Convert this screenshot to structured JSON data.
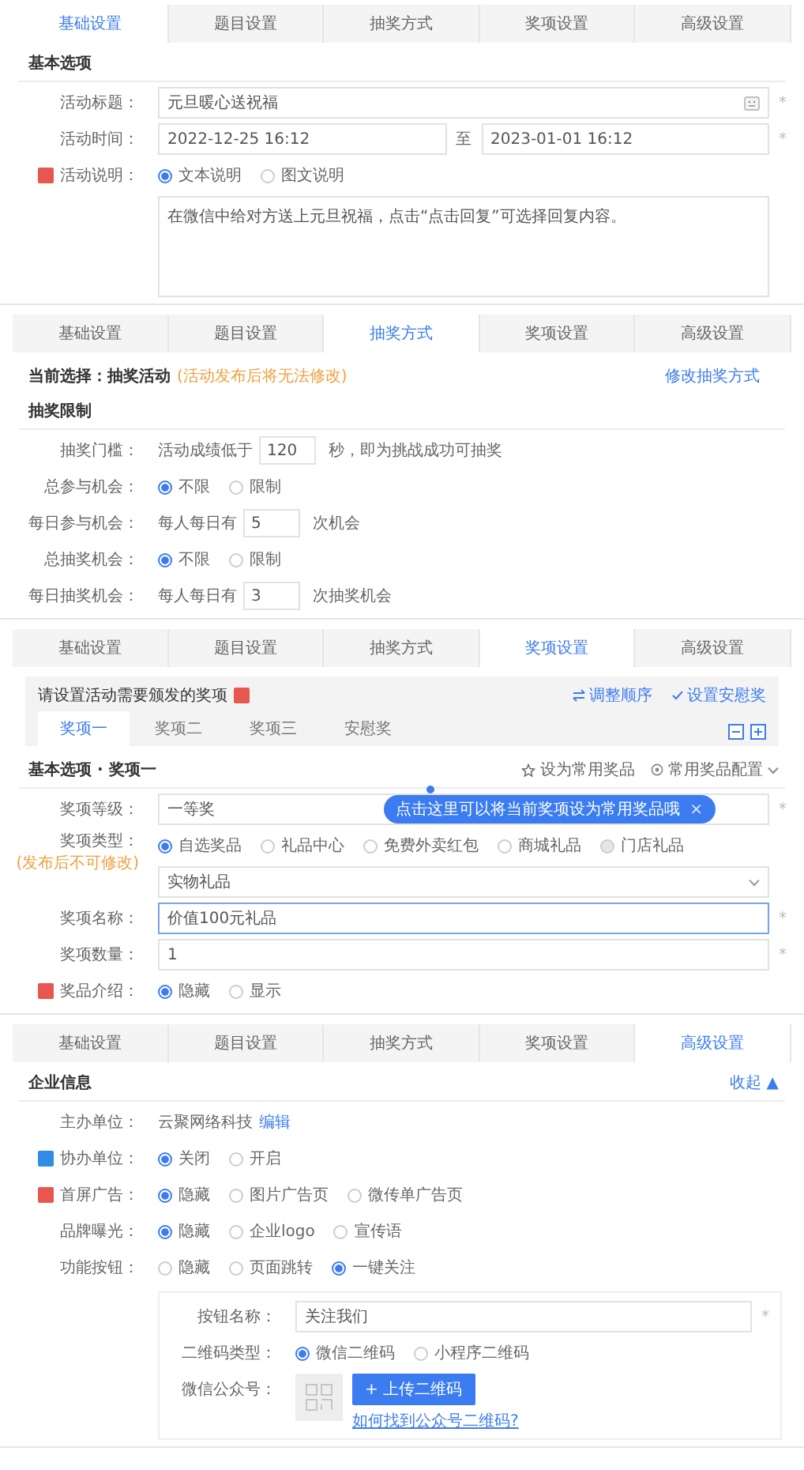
{
  "panels": [
    {
      "tabs": [
        {
          "label": "基础设置",
          "selected": true
        },
        {
          "label": "题目设置",
          "selected": false
        },
        {
          "label": "抽奖方式",
          "selected": false
        },
        {
          "label": "奖项设置",
          "selected": false
        },
        {
          "label": "高级设置",
          "selected": false
        }
      ],
      "section": {
        "title": "基本选项"
      },
      "rows": [
        {
          "kind": "emoji_input",
          "label": "活动标题：",
          "value": "元旦暖心送祝福",
          "required_mark": "*"
        },
        {
          "kind": "daterange",
          "label": "活动时间：",
          "start": "2022-12-25 16:12",
          "separator": "至",
          "end": "2023-01-01 16:12",
          "required_mark": "*"
        },
        {
          "kind": "radio",
          "label": "活动说明：",
          "color": "#e8574e",
          "options": [
            {
              "label": "文本说明",
              "selected": true
            },
            {
              "label": "图文说明",
              "selected": false
            }
          ],
          "textarea": "在微信中给对方送上元旦祝福，点击“点击回复”可选择回复内容。"
        }
      ]
    },
    {
      "tabs": [
        {
          "label": "基础设置",
          "selected": false
        },
        {
          "label": "题目设置",
          "selected": false
        },
        {
          "label": "抽奖方式",
          "selected": true
        },
        {
          "label": "奖项设置",
          "selected": false
        },
        {
          "label": "高级设置",
          "selected": false
        }
      ],
      "current": {
        "text": "当前选择：抽奖活动",
        "note": "(活动发布后将无法修改)",
        "link": "修改抽奖方式"
      },
      "section": {
        "title": "抽奖限制"
      },
      "rows": [
        {
          "kind": "inline",
          "label": "抽奖门槛：",
          "parts": [
            {
              "kind": "text",
              "text": "活动成绩低于"
            },
            {
              "kind": "input",
              "value": "120"
            },
            {
              "kind": "text",
              "text": "秒，即为挑战成功可抽奖"
            }
          ]
        },
        {
          "kind": "radio",
          "label": "总参与机会：",
          "options": [
            {
              "label": "不限",
              "selected": true
            },
            {
              "label": "限制",
              "selected": false
            }
          ]
        },
        {
          "kind": "inline",
          "label": "每日参与机会：",
          "parts": [
            {
              "kind": "text",
              "text": "每人每日有"
            },
            {
              "kind": "input",
              "value": "5"
            },
            {
              "kind": "text",
              "text": "次机会"
            }
          ]
        },
        {
          "kind": "radio",
          "label": "总抽奖机会：",
          "options": [
            {
              "label": "不限",
              "selected": true
            },
            {
              "label": "限制",
              "selected": false
            }
          ]
        },
        {
          "kind": "inline",
          "label": "每日抽奖机会：",
          "parts": [
            {
              "kind": "text",
              "text": "每人每日有"
            },
            {
              "kind": "input",
              "value": "3"
            },
            {
              "kind": "text",
              "text": "次抽奖机会"
            }
          ]
        }
      ]
    },
    {
      "tabs": [
        {
          "label": "基础设置",
          "selected": false
        },
        {
          "label": "题目设置",
          "selected": false
        },
        {
          "label": "抽奖方式",
          "selected": false
        },
        {
          "label": "奖项设置",
          "selected": true
        },
        {
          "label": "高级设置",
          "selected": false
        }
      ],
      "prize_box": {
        "title": "请设置活动需要颁发的奖项",
        "color": "#e8574e",
        "actions": [
          {
            "label": "调整顺序"
          },
          {
            "label": "设置安慰奖"
          }
        ],
        "tabs": [
          {
            "label": "奖项一",
            "selected": true
          },
          {
            "label": "奖项二",
            "selected": false
          },
          {
            "label": "奖项三",
            "selected": false
          },
          {
            "label": "安慰奖",
            "selected": false
          }
        ]
      },
      "section": {
        "title": "基本选项 · 奖项一",
        "actions": [
          {
            "label": "设为常用奖品",
            "caret": false
          },
          {
            "label": "常用奖品配置",
            "caret": true
          }
        ]
      },
      "tooltip": {
        "text": "点击这里可以将当前奖项设为常用奖品哦",
        "close": "×"
      },
      "rows": [
        {
          "kind": "input",
          "label": "奖项等级：",
          "value": "一等奖",
          "required_mark": "*"
        },
        {
          "kind": "radio",
          "label": "奖项类型：",
          "note": "(发布后不可修改)",
          "options": [
            {
              "label": "自选奖品",
              "selected": true,
              "disabled": false
            },
            {
              "label": "礼品中心",
              "selected": false,
              "disabled": false
            },
            {
              "label": "免费外卖红包",
              "selected": false,
              "disabled": false
            },
            {
              "label": "商城礼品",
              "selected": false,
              "disabled": false
            },
            {
              "label": "门店礼品",
              "selected": false,
              "disabled": true
            }
          ],
          "select": "实物礼品"
        },
        {
          "kind": "input",
          "label": "奖项名称：",
          "value": "价值100元礼品",
          "focused": true,
          "required_mark": "*"
        },
        {
          "kind": "input",
          "label": "奖项数量：",
          "value": "1",
          "focused": false,
          "required_mark": "*"
        },
        {
          "kind": "radio",
          "label": "奖品介绍：",
          "color": "#e8574e",
          "options": [
            {
              "label": "隐藏",
              "selected": true
            },
            {
              "label": "显示",
              "selected": false
            }
          ]
        }
      ]
    },
    {
      "tabs": [
        {
          "label": "基础设置",
          "selected": false
        },
        {
          "label": "题目设置",
          "selected": false
        },
        {
          "label": "抽奖方式",
          "selected": false
        },
        {
          "label": "奖项设置",
          "selected": false
        },
        {
          "label": "高级设置",
          "selected": true
        }
      ],
      "section": {
        "title": "企业信息",
        "link": "收起 ▲"
      },
      "rows": [
        {
          "kind": "text_link",
          "label": "主办单位：",
          "text": "云聚网络科技",
          "link": "编辑"
        },
        {
          "kind": "radio",
          "label": "协办单位：",
          "color": "#2f8de4",
          "options": [
            {
              "label": "关闭",
              "selected": true
            },
            {
              "label": "开启",
              "selected": false
            }
          ]
        },
        {
          "kind": "radio",
          "label": "首屏广告：",
          "color": "#e8574e",
          "options": [
            {
              "label": "隐藏",
              "selected": true
            },
            {
              "label": "图片广告页",
              "selected": false
            },
            {
              "label": "微传单广告页",
              "selected": false
            }
          ]
        },
        {
          "kind": "radio",
          "label": "品牌曝光：",
          "options": [
            {
              "label": "隐藏",
              "selected": true
            },
            {
              "label": "企业logo",
              "selected": false
            },
            {
              "label": "宣传语",
              "selected": false
            }
          ]
        },
        {
          "kind": "radio",
          "label": "功能按钮：",
          "options": [
            {
              "label": "隐藏",
              "selected": false
            },
            {
              "label": "页面跳转",
              "selected": false
            },
            {
              "label": "一键关注",
              "selected": true
            }
          ],
          "subrows": [
            {
              "kind": "input",
              "label": "按钮名称：",
              "value": "关注我们",
              "required_mark": "*"
            },
            {
              "kind": "radio",
              "label": "二维码类型：",
              "options": [
                {
                  "label": "微信二维码",
                  "selected": true
                },
                {
                  "label": "小程序二维码",
                  "selected": false
                }
              ]
            },
            {
              "kind": "upload",
              "label": "微信公众号：",
              "button": "+ 上传二维码",
              "link": "如何找到公众号二维码?"
            }
          ]
        }
      ]
    }
  ]
}
